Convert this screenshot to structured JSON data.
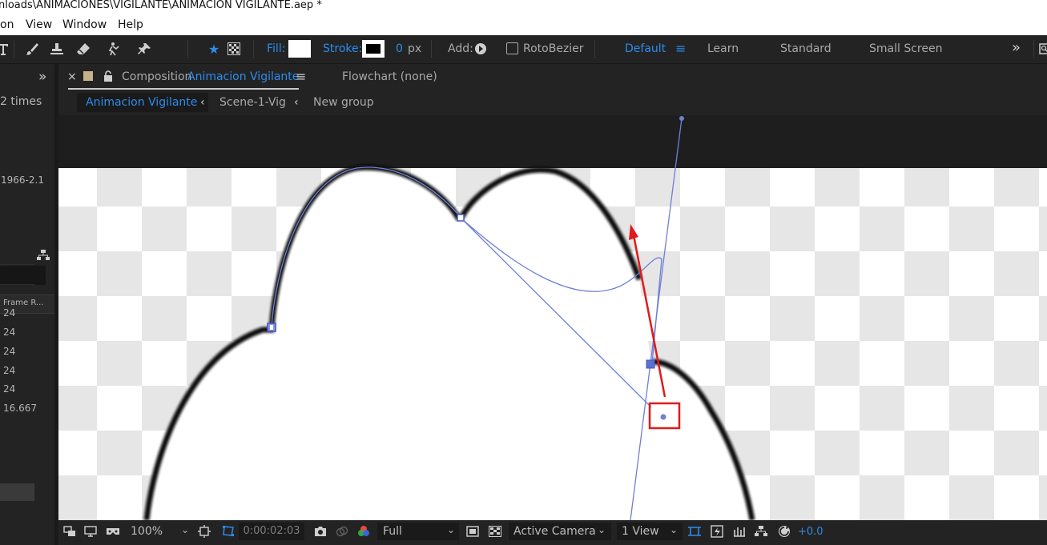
{
  "title_bar": {
    "text": "nloads\\ANIMACIONES\\VIGILANTE\\ANIMACION VIGILANTE.aep *"
  },
  "menu": [
    "on",
    "View",
    "Window",
    "Help"
  ],
  "toolbar": {
    "icons": [
      "type-tool-icon",
      "brush-tool-icon",
      "clone-stamp-tool-icon",
      "eraser-tool-icon",
      "roto-brush-tool-icon",
      "puppet-pin-tool-icon"
    ],
    "fill_label": "Fill:",
    "stroke_label": "Stroke:",
    "stroke_width": "0",
    "stroke_unit": "px",
    "add_label": "Add:",
    "rotobezier_label": "RotoBezier",
    "workspaces": {
      "active": "Default",
      "others": [
        "Learn",
        "Standard",
        "Small Screen"
      ]
    },
    "more_glyph": "»"
  },
  "left_panel": {
    "collapse_glyph": "»",
    "times_text": "2 times",
    "version_text": "1966-2.1",
    "column_header": "Frame R...",
    "frame_rates": [
      "24",
      "24",
      "24",
      "24",
      "24",
      "16.667"
    ]
  },
  "comp_panel": {
    "close_glyph": "×",
    "tab_prefix": "Composition",
    "tab_name": "Animacion Vigilante",
    "menu_glyph": "≡",
    "flowchart_label": "Flowchart (none)"
  },
  "breadcrumbs": [
    "Animacion Vigilante",
    "Scene-1-Vig",
    "New group"
  ],
  "bottom_bar": {
    "zoom": "100%",
    "timecode": "0:00:02:03",
    "resolution": "Full",
    "camera": "Active Camera",
    "views": "1 View",
    "exposure": "+0.0"
  },
  "colors": {
    "accent": "#2d8ceb",
    "path": "#6f7fd6",
    "annotation": "#e01a1a",
    "panel": "#232323"
  }
}
